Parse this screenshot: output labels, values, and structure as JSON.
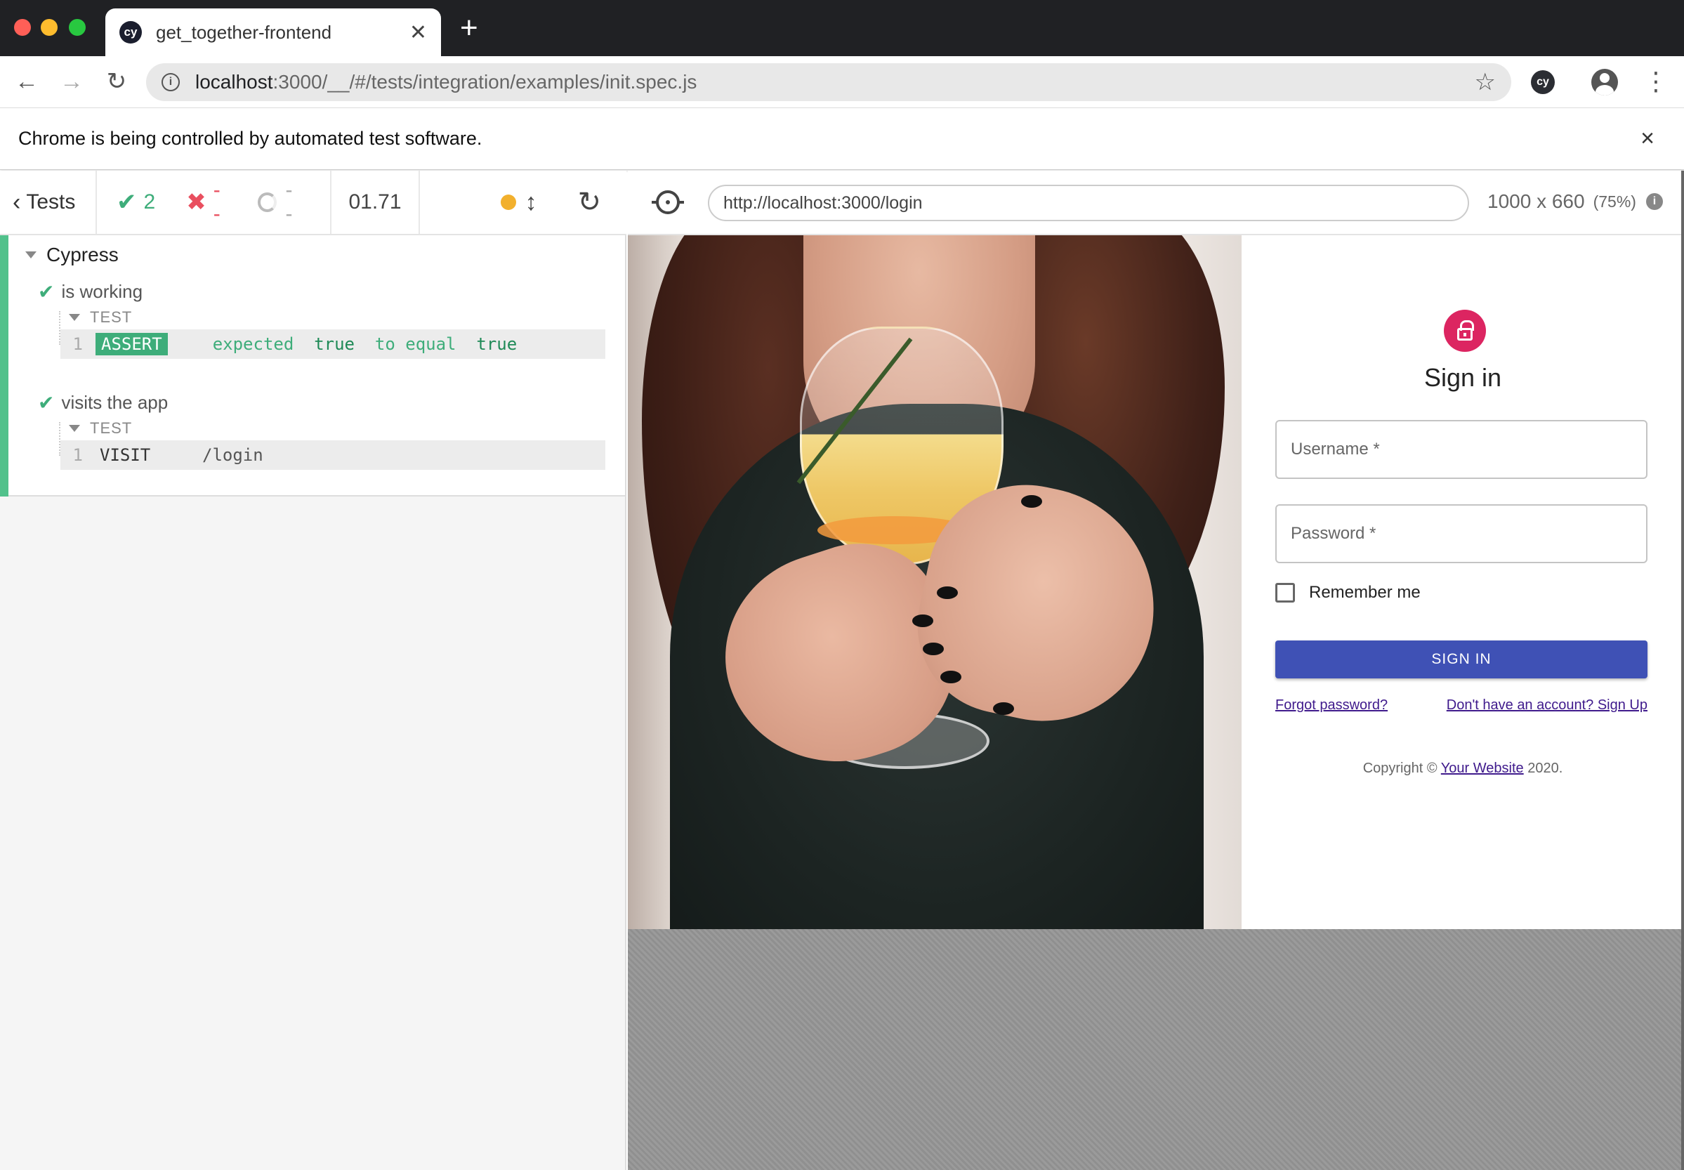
{
  "browser": {
    "tab_title": "get_together-frontend",
    "tab_favicon": "cy",
    "new_tab": "+",
    "url_host": "localhost",
    "url_rest": ":3000/__/#/tests/integration/examples/init.spec.js",
    "extension_label": "cy",
    "infobar_text": "Chrome is being controlled by automated test software.",
    "infobar_close": "×"
  },
  "reporter": {
    "back_label": "Tests",
    "passed": "2",
    "failed": "--",
    "pending": "--",
    "duration": "01.71",
    "suite": "Cypress",
    "tests": [
      {
        "title": "is working",
        "hook": "TEST",
        "command": {
          "num": "1",
          "name": "ASSERT",
          "msg_parts": [
            "expected",
            "true",
            "to equal",
            "true"
          ]
        }
      },
      {
        "title": "visits the app",
        "hook": "TEST",
        "command": {
          "num": "1",
          "name": "VISIT",
          "msg": "/login"
        }
      }
    ],
    "colors": {
      "pass": "#3ead7a",
      "fail": "#e94f5f",
      "running": "#f2b02d"
    }
  },
  "aut": {
    "url": "http://localhost:3000/login",
    "size": "1000 x 660",
    "scale": "(75%)"
  },
  "login": {
    "title": "Sign in",
    "username_placeholder": "Username *",
    "password_placeholder": "Password *",
    "remember_label": "Remember me",
    "signin_button": "SIGN IN",
    "forgot_link": "Forgot password?",
    "signup_link": "Don't have an account? Sign Up",
    "copyright_prefix": "Copyright ©",
    "copyright_link": "Your Website",
    "copyright_year": "2020.",
    "colors": {
      "avatar": "#dc2561",
      "button": "#3f51b5"
    }
  },
  "icons": [
    "lock-icon",
    "selector-playground-icon",
    "reload-icon",
    "back-icon",
    "forward-icon",
    "star-icon",
    "profile-icon",
    "menu-icon",
    "check-icon",
    "x-icon",
    "spinner-icon",
    "scroll-icon",
    "rerun-icon",
    "info-icon"
  ]
}
